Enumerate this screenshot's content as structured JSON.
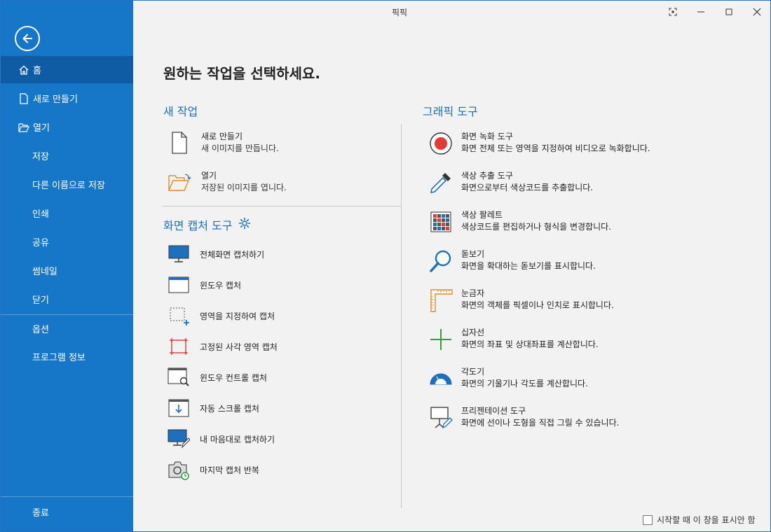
{
  "app": {
    "title": "픽픽"
  },
  "sidebar": {
    "items": [
      {
        "label": "홈",
        "icon": "home-icon"
      },
      {
        "label": "새로 만들기",
        "icon": "new-file-icon"
      },
      {
        "label": "열기",
        "icon": "open-folder-icon"
      },
      {
        "label": "저장"
      },
      {
        "label": "다른 이름으로 저장"
      },
      {
        "label": "인쇄"
      },
      {
        "label": "공유"
      },
      {
        "label": "썸네일"
      },
      {
        "label": "닫기"
      },
      {
        "label": "옵션"
      },
      {
        "label": "프로그램 정보"
      },
      {
        "label": "종료"
      }
    ]
  },
  "main": {
    "heading": "원하는 작업을 선택하세요.",
    "new_task": {
      "title": "새 작업",
      "items": [
        {
          "title": "새로 만들기",
          "desc": "새 이미지를 만듭니다."
        },
        {
          "title": "열기",
          "desc": "저장된 이미지를 엽니다."
        }
      ]
    },
    "capture": {
      "title": "화면 캡처 도구",
      "items": [
        {
          "label": "전체화면 캡처하기"
        },
        {
          "label": "윈도우 캡처"
        },
        {
          "label": "영역을 지정하여 캡처"
        },
        {
          "label": "고정된 사각 영역 캡처"
        },
        {
          "label": "윈도우 컨트롤 캡처"
        },
        {
          "label": "자동 스크롤 캡처"
        },
        {
          "label": "내 마음대로 캡처하기"
        },
        {
          "label": "마지막 캡처 반복"
        }
      ]
    },
    "graphic": {
      "title": "그래픽 도구",
      "items": [
        {
          "title": "화면 녹화 도구",
          "desc": "화면 전체 또는 영역을 지정하여 비디오로 녹화합니다."
        },
        {
          "title": "색상 추출 도구",
          "desc": "화면으로부터 색상코드를 추출합니다."
        },
        {
          "title": "색상 팔레트",
          "desc": "색상코드를 편집하거나 형식을 변경합니다."
        },
        {
          "title": "돋보기",
          "desc": "화면을 확대하는 돋보기를 표시합니다."
        },
        {
          "title": "눈금자",
          "desc": "화면의 객체를 픽셀이나 인치로 표시합니다."
        },
        {
          "title": "십자선",
          "desc": "화면의 좌표 및 상대좌표를 계산합니다."
        },
        {
          "title": "각도기",
          "desc": "화면의 기울기나 각도를 계산합니다."
        },
        {
          "title": "프리젠테이션 도구",
          "desc": "화면에 선이나 도형을 직접 그릴 수 있습니다."
        }
      ]
    }
  },
  "footer": {
    "startup_label": "시작할 때 이 창을 표시안 함"
  },
  "colors": {
    "sidebar": "#1677c9",
    "sidebar_active": "#0f5ca5",
    "accent": "#1a6fc0",
    "record_red": "#e53935"
  }
}
